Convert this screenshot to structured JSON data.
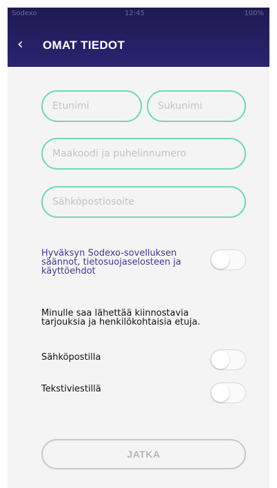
{
  "status_bar": {
    "carrier": "Sodexo",
    "time": "12:45",
    "battery": "100%"
  },
  "header": {
    "title": "OMAT TIEDOT"
  },
  "form": {
    "first_name_placeholder": "Etunimi",
    "last_name_placeholder": "Sukunimi",
    "phone_placeholder": "Maakoodi ja puhelinnumero",
    "email_placeholder": "Sähköpostiosoite"
  },
  "consent": {
    "terms_text": "Hyväksyn Sodexo-sovelluksen säännot, tietosuojaselosteen ja käyttöehdot",
    "terms_toggle_on": false
  },
  "marketing": {
    "intro": "Minulle saa lähettää kiinnostavia tarjouksia ja henkilökohtaisia etuja.",
    "email_label": "Sähköpostilla",
    "email_toggle_on": false,
    "sms_label": "Tekstiviestillä",
    "sms_toggle_on": false
  },
  "footer": {
    "continue_label": "JATKA"
  },
  "colors": {
    "header_bg": "#221d5c",
    "field_border": "#6ed7be",
    "link_text": "#3d3a8f"
  }
}
